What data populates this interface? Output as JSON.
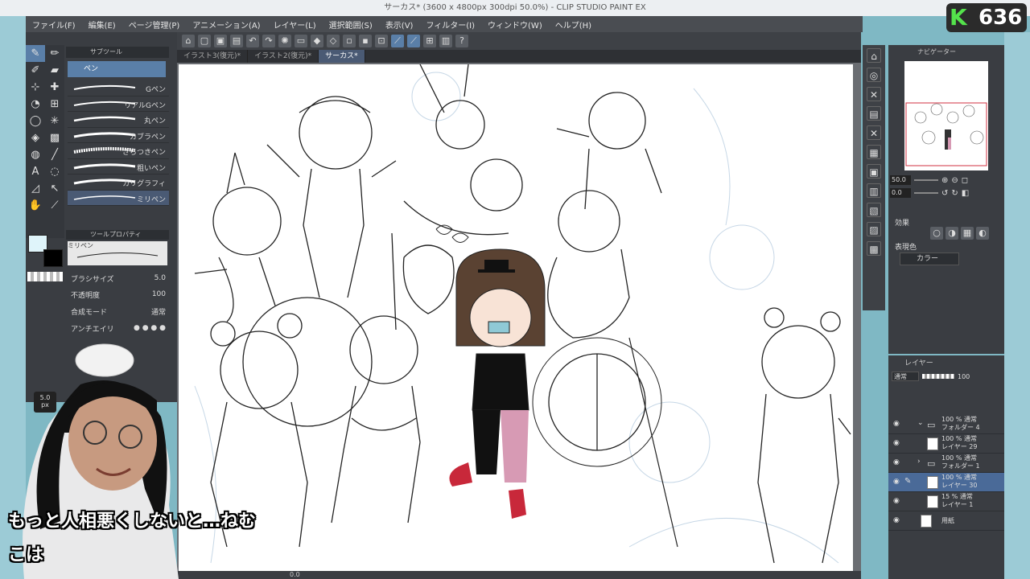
{
  "window": {
    "title": "サーカス* (3600 x 4800px 300dpi 50.0%) - CLIP STUDIO PAINT EX"
  },
  "menu": [
    "ファイル(F)",
    "編集(E)",
    "ページ管理(P)",
    "アニメーション(A)",
    "レイヤー(L)",
    "選択範囲(S)",
    "表示(V)",
    "フィルター(I)",
    "ウィンドウ(W)",
    "ヘルプ(H)"
  ],
  "doc_tabs": [
    {
      "label": "イラスト3(復元)*",
      "active": false
    },
    {
      "label": "イラスト2(復元)*",
      "active": false
    },
    {
      "label": "サーカス*",
      "active": true
    }
  ],
  "left_panel": {
    "subtool_title": "サブツール",
    "subtool_group": "ペン",
    "brushes": [
      {
        "label": "Gペン"
      },
      {
        "label": "リアルGペン"
      },
      {
        "label": "丸ペン"
      },
      {
        "label": "カブラペン"
      },
      {
        "label": "ざらつきペン"
      },
      {
        "label": "粗いペン"
      },
      {
        "label": "カリグラフィ"
      },
      {
        "label": "ミリペン",
        "selected": true
      }
    ],
    "tool_property_title": "ツールプロパティ",
    "tool_property_brush": "ミリペン",
    "brush_size_label": "ブラシサイズ",
    "brush_size_value": "5.0",
    "opacity_label": "不透明度",
    "opacity_value": "100",
    "blend_label": "合成モード",
    "blend_value": "通常",
    "antialias_label": "アンチエイリ",
    "size_indicator": "5.0",
    "size_unit": "px",
    "main_color": "#dff4fa",
    "sub_color": "#000000"
  },
  "navigator": {
    "title": "ナビゲーター",
    "zoom": "50.0",
    "rotation": "0.0"
  },
  "effect_panel": {
    "title": "効果",
    "expression_label": "表現色",
    "expression_value": "カラー"
  },
  "layer_panel": {
    "title": "レイヤー",
    "blend_mode": "通常",
    "opacity": "100",
    "layers": [
      {
        "pct": "100 % 通常",
        "name": "フォルダー 4",
        "type": "folder",
        "selected": false
      },
      {
        "pct": "100 % 通常",
        "name": "レイヤー 29",
        "type": "raster",
        "selected": false
      },
      {
        "pct": "100 % 通常",
        "name": "フォルダー 1",
        "type": "folder",
        "selected": false
      },
      {
        "pct": "100 % 通常",
        "name": "レイヤー 30",
        "type": "raster",
        "selected": true
      },
      {
        "pct": "15 % 通常",
        "name": "レイヤー 1",
        "type": "raster",
        "selected": false
      },
      {
        "pct": "",
        "name": "用紙",
        "type": "paper",
        "selected": false
      }
    ]
  },
  "status": {
    "zoom": "0.0"
  },
  "badge": {
    "letter": "K",
    "count": "636"
  },
  "subtitles": {
    "line1": "もっと人相悪くしないと…ねむ",
    "line2": "こは"
  }
}
